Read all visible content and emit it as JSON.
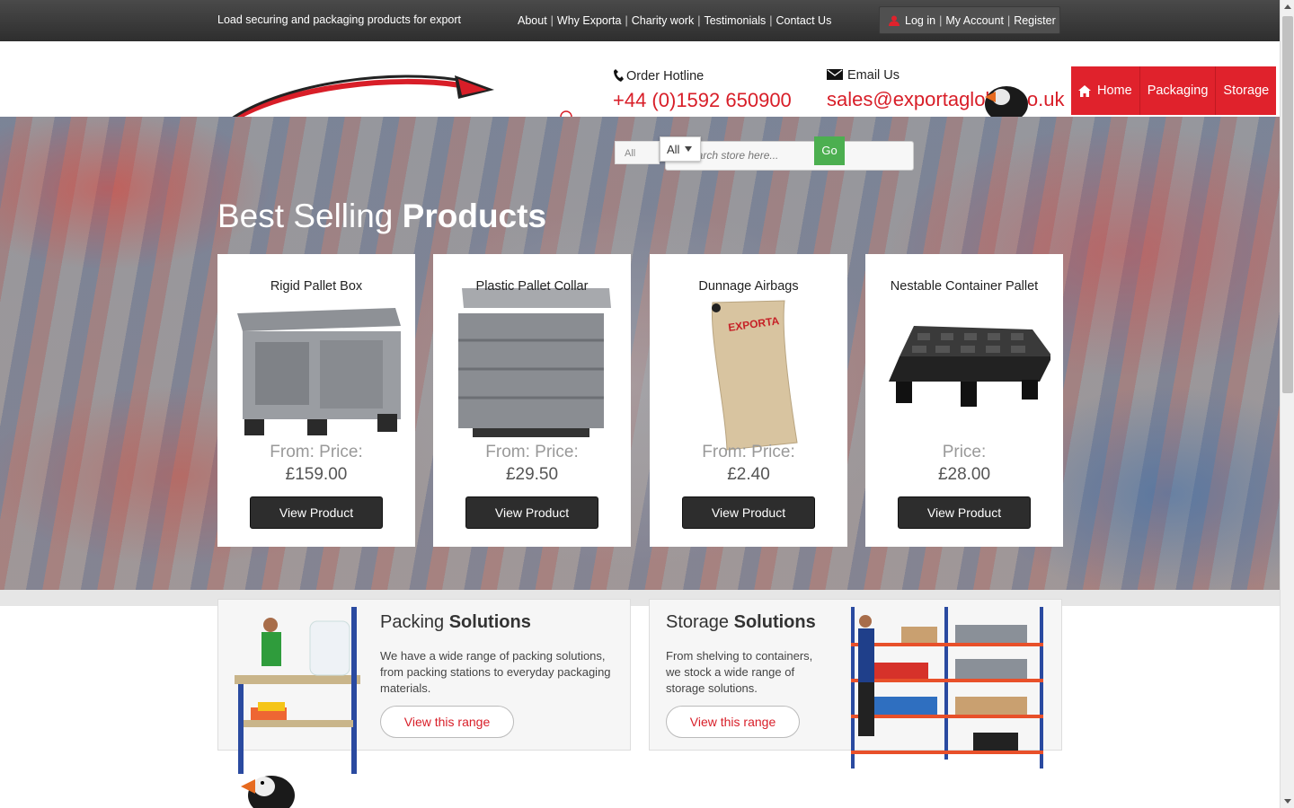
{
  "topbar": {
    "tagline": "Load securing and packaging products for export",
    "links": [
      "About",
      "Why Exporta",
      "Charity work",
      "Testimonials",
      "Contact Us"
    ],
    "account_links": [
      "Log in",
      "My Account",
      "Register"
    ],
    "separator": "|"
  },
  "header": {
    "hotline_label": "Order Hotline",
    "hotline_value": "+44 (0)1592 650900",
    "email_label": "Email Us",
    "email_value": "sales@exportaglobal.co.uk",
    "accent_color": "#d81e28"
  },
  "nav": {
    "items": [
      "Home",
      "Packaging",
      "Storage"
    ]
  },
  "search": {
    "small_select": "All",
    "select_value": "All",
    "placeholder": "Search store here...",
    "go_label": "Go"
  },
  "best_selling": {
    "title_light": "Best Selling",
    "title_bold": "Products",
    "products": [
      {
        "name": "Rigid Pallet Box",
        "price_label": "From: Price:",
        "price": "£159.00",
        "button": "View Product"
      },
      {
        "name": "Plastic Pallet Collar",
        "price_label": "From: Price:",
        "price": "£29.50",
        "button": "View Product"
      },
      {
        "name": "Dunnage Airbags",
        "price_label": "From: Price:",
        "price": "£2.40",
        "button": "View Product"
      },
      {
        "name": "Nestable Container Pallet",
        "price_label": "Price:",
        "price": "£28.00",
        "button": "View Product"
      }
    ]
  },
  "solutions": [
    {
      "title_light": "Packing",
      "title_bold": "Solutions",
      "text": "We have a wide range of packing solutions, from packing stations to everyday packaging materials.",
      "button": "View this range"
    },
    {
      "title_light": "Storage",
      "title_bold": "Solutions",
      "text": "From shelving to containers, we stock a wide range of storage solutions.",
      "button": "View this range"
    }
  ]
}
